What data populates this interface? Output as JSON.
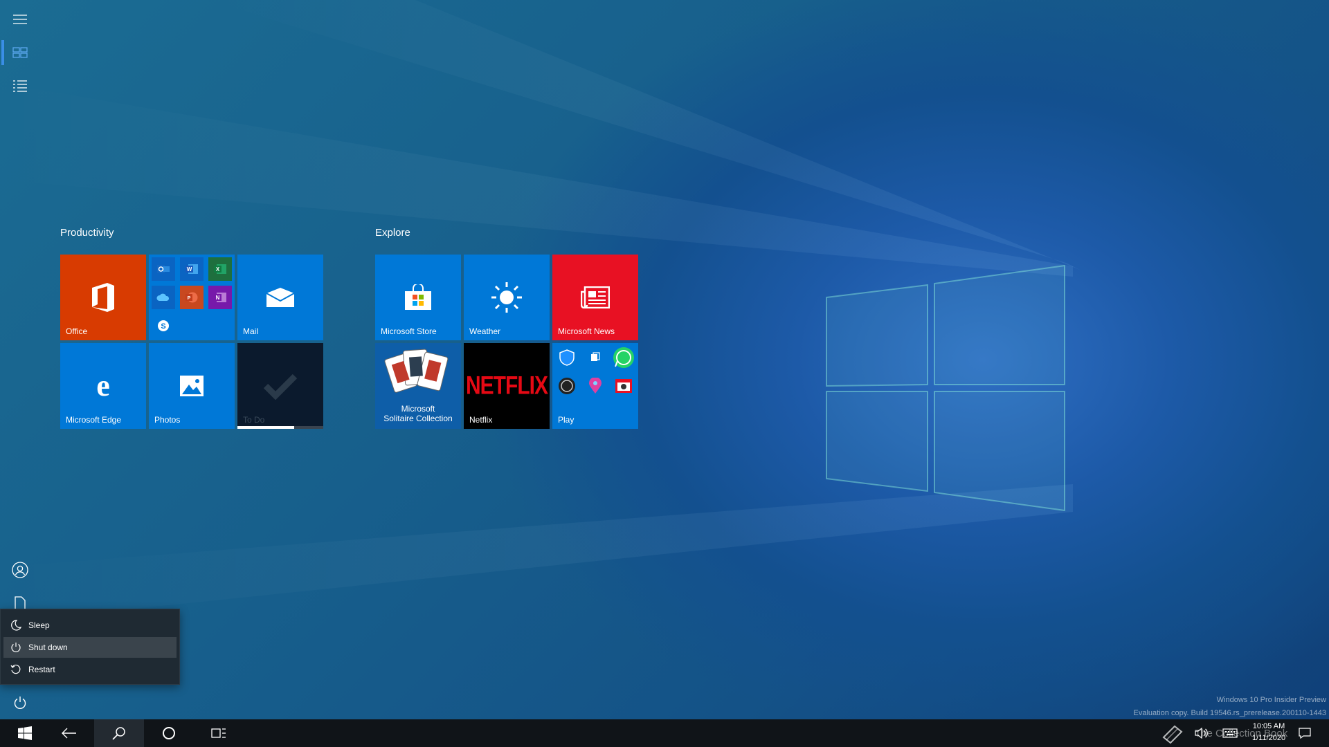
{
  "start": {
    "groups": [
      {
        "title": "Productivity"
      },
      {
        "title": "Explore"
      }
    ],
    "tiles": {
      "office": {
        "label": "Office",
        "color": "#d83b01"
      },
      "office_apps": {
        "color": "#0078d7"
      },
      "mail": {
        "label": "Mail",
        "color": "#0078d7"
      },
      "edge": {
        "label": "Microsoft Edge",
        "color": "#0078d7"
      },
      "photos": {
        "label": "Photos",
        "color": "#0078d7"
      },
      "todo": {
        "label": "To Do",
        "color": "#0b1a2d"
      },
      "store": {
        "label": "Microsoft Store",
        "color": "#0078d7"
      },
      "weather": {
        "label": "Weather",
        "color": "#0078d7"
      },
      "news": {
        "label": "Microsoft News",
        "color": "#e81123"
      },
      "solitaire": {
        "label_line1": "Microsoft",
        "label_line2": "Solitaire Collection",
        "color": "#0e5ea8"
      },
      "netflix": {
        "label": "Netflix",
        "logo_text": "NETFLIX",
        "color": "#000000"
      },
      "play": {
        "label": "Play",
        "color": "#0078d7"
      }
    }
  },
  "power_menu": {
    "items": [
      {
        "label": "Sleep",
        "icon": "moon-icon"
      },
      {
        "label": "Shut down",
        "icon": "power-icon"
      },
      {
        "label": "Restart",
        "icon": "restart-icon"
      }
    ]
  },
  "watermark": {
    "line1": "Windows 10 Pro Insider Preview",
    "line2": "Evaluation copy. Build 19546.rs_prerelease.200110-1443",
    "line3": "The Collection Book"
  },
  "tray": {
    "time": "10:05 AM",
    "date": "1/11/2020"
  }
}
